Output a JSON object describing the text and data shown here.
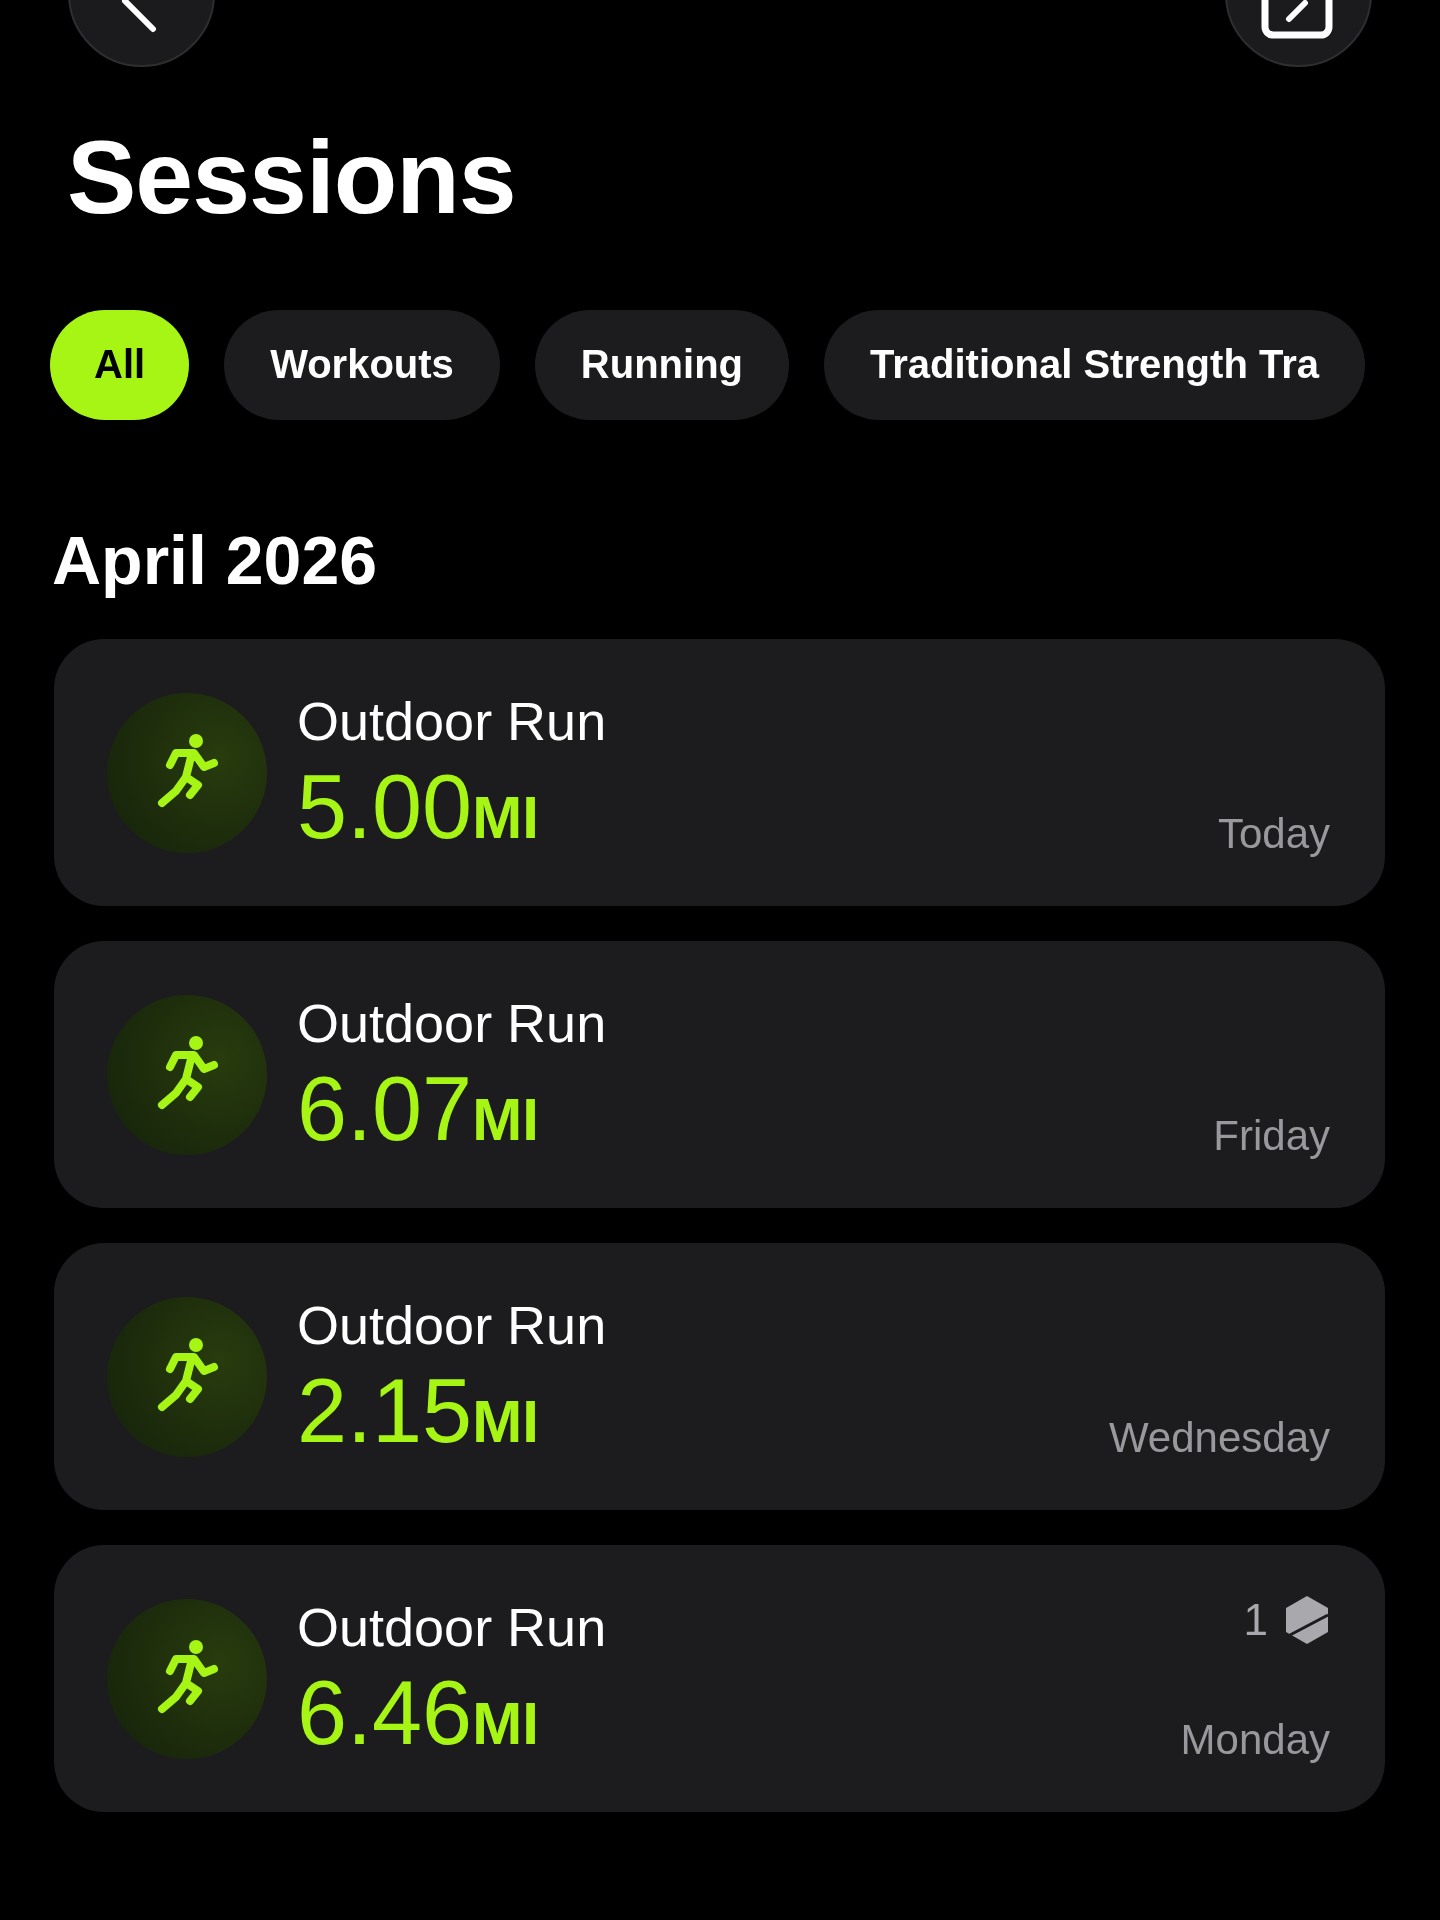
{
  "title": "Sessions",
  "filters": [
    {
      "label": "All",
      "selected": true
    },
    {
      "label": "Workouts",
      "selected": false
    },
    {
      "label": "Running",
      "selected": false
    },
    {
      "label": "Traditional Strength Tra",
      "selected": false
    }
  ],
  "sections": [
    {
      "heading": "April 2026",
      "sessions": [
        {
          "name": "Outdoor Run",
          "value": "5.00",
          "unit": "MI",
          "day": "Today"
        },
        {
          "name": "Outdoor Run",
          "value": "6.07",
          "unit": "MI",
          "day": "Friday"
        },
        {
          "name": "Outdoor Run",
          "value": "2.15",
          "unit": "MI",
          "day": "Wednesday"
        },
        {
          "name": "Outdoor Run",
          "value": "6.46",
          "unit": "MI",
          "day": "Monday",
          "badge": "1"
        }
      ]
    }
  ]
}
